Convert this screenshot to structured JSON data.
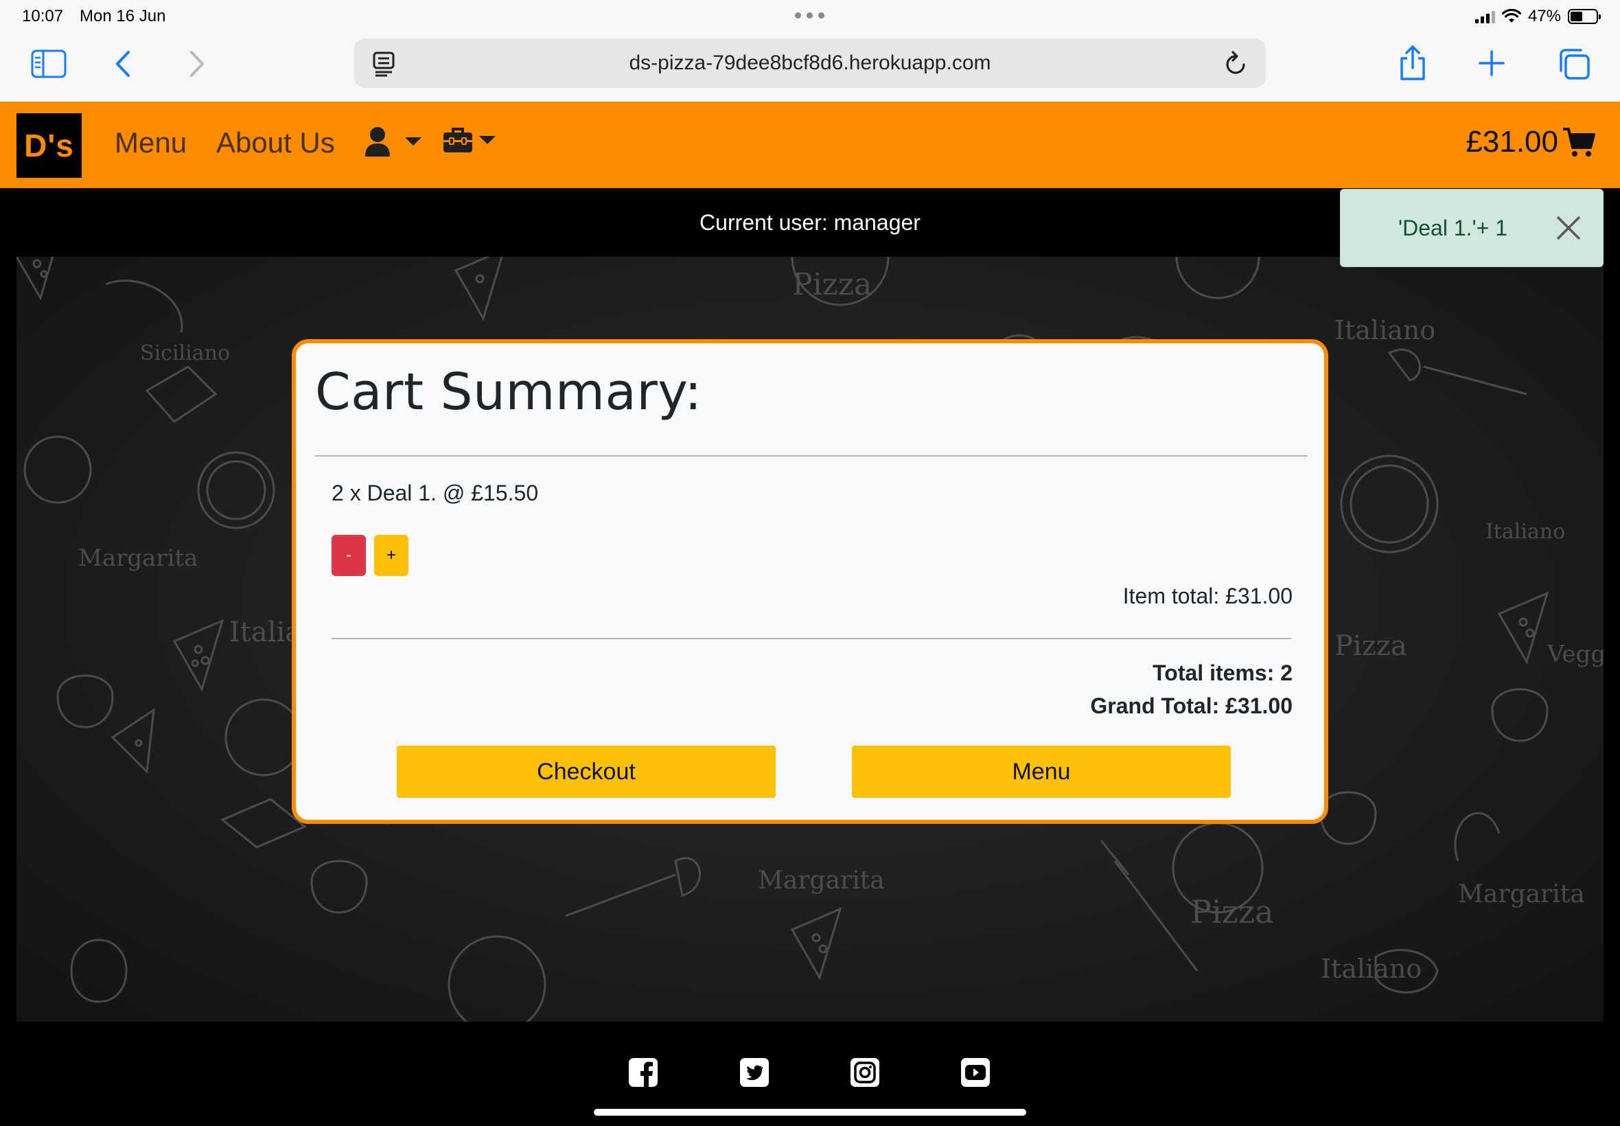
{
  "status_bar": {
    "time": "10:07",
    "date": "Mon 16 Jun",
    "battery": "47%",
    "battery_level": 0.47
  },
  "browser": {
    "url": "ds-pizza-79dee8bcf8d6.herokuapp.com",
    "accent_color": "#1a7cf5",
    "icons": [
      "sidebar-icon",
      "back-icon",
      "forward-icon",
      "reader-icon",
      "reload-icon",
      "share-icon",
      "new-tab-icon",
      "tabs-icon"
    ]
  },
  "nav": {
    "logo": "D's",
    "links": [
      "Menu",
      "About Us"
    ],
    "icons": [
      "user-icon",
      "toolbox-icon",
      "cart-icon"
    ],
    "cart_total": "£31.00",
    "brand_color": "#fd8c00"
  },
  "current_user": "Current user: manager",
  "toast": {
    "message": "'Deal 1.'+ 1"
  },
  "cart": {
    "title": "Cart Summary:",
    "item": "2 x Deal 1. @ £15.50",
    "minus_label": "-",
    "plus_label": "+",
    "item_total": "Item total: £31.00",
    "total_items": "Total items: 2",
    "grand_total": "Grand Total: £31.00",
    "checkout_label": "Checkout",
    "menu_label": "Menu"
  },
  "footer": {
    "social_icons": [
      "facebook-icon",
      "twitter-icon",
      "instagram-icon",
      "youtube-icon"
    ]
  }
}
